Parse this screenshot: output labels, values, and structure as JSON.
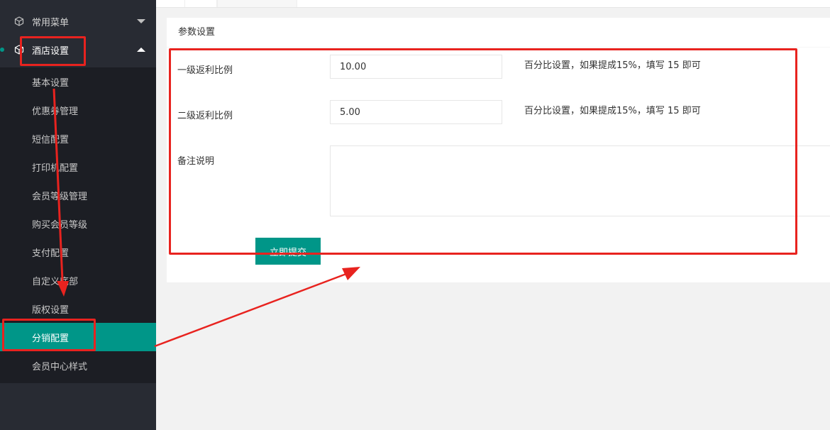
{
  "sidebar": {
    "groups": [
      {
        "label": "常用菜单",
        "icon": "cube-icon",
        "state": "collapsed"
      },
      {
        "label": "酒店设置",
        "icon": "cube-icon",
        "state": "expanded"
      }
    ],
    "items": [
      {
        "label": "基本设置"
      },
      {
        "label": "优惠券管理"
      },
      {
        "label": "短信配置"
      },
      {
        "label": "打印机配置"
      },
      {
        "label": "会员等级管理"
      },
      {
        "label": "购买会员等级"
      },
      {
        "label": "支付配置"
      },
      {
        "label": "自定义底部"
      },
      {
        "label": "版权设置"
      },
      {
        "label": "分销配置",
        "active": true
      },
      {
        "label": "会员中心样式"
      }
    ]
  },
  "card": {
    "title": "参数设置",
    "fields": [
      {
        "label": "一级返利比例",
        "value": "10.00",
        "hint": "百分比设置，如果提成15%，填写 15 即可"
      },
      {
        "label": "二级返利比例",
        "value": "5.00",
        "hint": "百分比设置，如果提成15%，填写 15 即可"
      },
      {
        "label": "备注说明",
        "value": ""
      }
    ],
    "submit_label": "立即提交"
  },
  "colors": {
    "accent": "#009688",
    "sidebar_bg": "#282b33",
    "submenu_bg": "#1c1e24",
    "annotation": "#e8231f"
  }
}
